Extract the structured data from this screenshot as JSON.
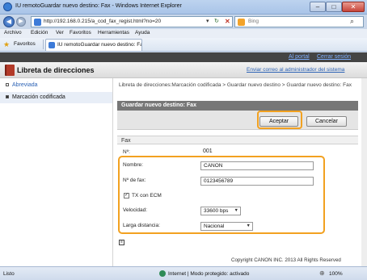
{
  "window": {
    "title": "IU remotoGuardar nuevo destino: Fax",
    "title_suffix": "- Windows Internet Explorer",
    "min": "–",
    "max": "□",
    "close": "✕"
  },
  "address": {
    "url": "http://192.168.0.215/a_cod_fax_regist.html?no=20",
    "dropdown": "▾",
    "refresh": "↻",
    "stop": "✕",
    "search_placeholder": "Bing",
    "search_glyph": "⌕"
  },
  "menu": [
    "Archivo",
    "Edición",
    "Ver",
    "Favoritos",
    "Herramientas",
    "Ayuda"
  ],
  "favbar": {
    "favorites_label": "Favoritos",
    "tab_title": "IU remotoGuardar nuevo destino: Fax"
  },
  "topbar": {
    "portal": "Al portal",
    "logout": "Cerrar sesión"
  },
  "header": {
    "title": "Libreta de direcciones",
    "admin_link": "Enviar correo al administrador del sistema"
  },
  "sidebar": {
    "items": [
      {
        "label": "Abreviada"
      },
      {
        "label": "Marcación codificada"
      }
    ]
  },
  "breadcrumb": "Libreta de direcciones:Marcación codificada > Guardar nuevo destino > Guardar nuevo destino: Fax",
  "panel": {
    "title": "Guardar nuevo destino: Fax",
    "ok": "Aceptar",
    "cancel": "Cancelar"
  },
  "fax": {
    "section": "Fax",
    "number_label": "Nº:",
    "number_value": "001",
    "name_label": "Nombre:",
    "name_value": "CANON",
    "fax_label": "Nº de fax:",
    "fax_value": "0123456789",
    "ecm_label": "TX con ECM",
    "ecm_checked": true,
    "speed_label": "Velocidad:",
    "speed_value": "33600 bps",
    "ld_label": "Larga distancia:",
    "ld_value": "Nacional"
  },
  "footer": {
    "copyright": "Copyright CANON INC. 2013 All Rights Reserved"
  },
  "status": {
    "left": "Listo",
    "zone": "Internet | Modo protegido: activado",
    "zoom": "100%"
  }
}
